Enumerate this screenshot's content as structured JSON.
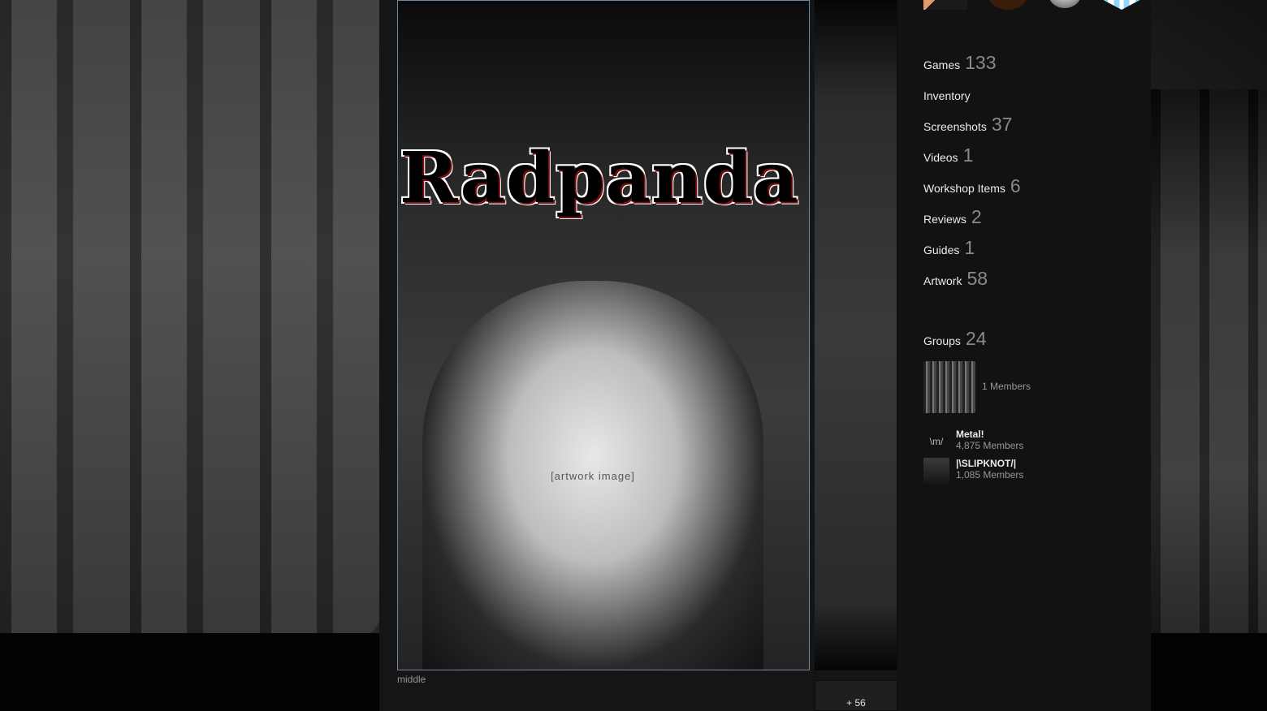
{
  "showcase": {
    "artwork_title_text": "Radpanda",
    "artwork_placeholder": "[artwork image]",
    "caption": "middle",
    "more_label": "+ 56"
  },
  "sidebar": {
    "badges": [
      "badge-1",
      "badge-2",
      "badge-3",
      "badge-4"
    ],
    "stats": [
      {
        "label": "Games",
        "count": "133"
      },
      {
        "label": "Inventory",
        "count": ""
      },
      {
        "label": "Screenshots",
        "count": "37"
      },
      {
        "label": "Videos",
        "count": "1"
      },
      {
        "label": "Workshop Items",
        "count": "6"
      },
      {
        "label": "Reviews",
        "count": "2"
      },
      {
        "label": "Guides",
        "count": "1"
      },
      {
        "label": "Artwork",
        "count": "58"
      }
    ],
    "groups": {
      "label": "Groups",
      "count": "24",
      "items": [
        {
          "name": "",
          "members": "1 Members",
          "avatar_text": ""
        },
        {
          "name": "Metal!",
          "members": "4,875 Members",
          "avatar_text": "\\m/"
        },
        {
          "name": "|\\SLIPKNOT/|",
          "members": "1,085 Members",
          "avatar_text": ""
        }
      ]
    }
  }
}
